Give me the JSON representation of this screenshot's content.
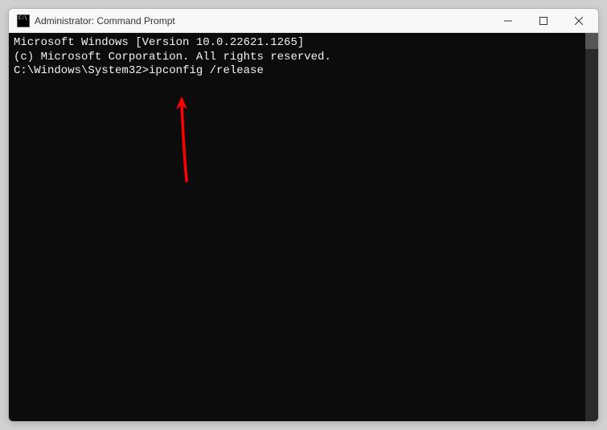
{
  "titlebar": {
    "title": "Administrator: Command Prompt"
  },
  "terminal": {
    "line1": "Microsoft Windows [Version 10.0.22621.1265]",
    "line2": "(c) Microsoft Corporation. All rights reserved.",
    "blank": "",
    "prompt": "C:\\Windows\\System32>",
    "command": "ipconfig /release"
  },
  "annotation": {
    "arrow_color": "#ff0000"
  }
}
